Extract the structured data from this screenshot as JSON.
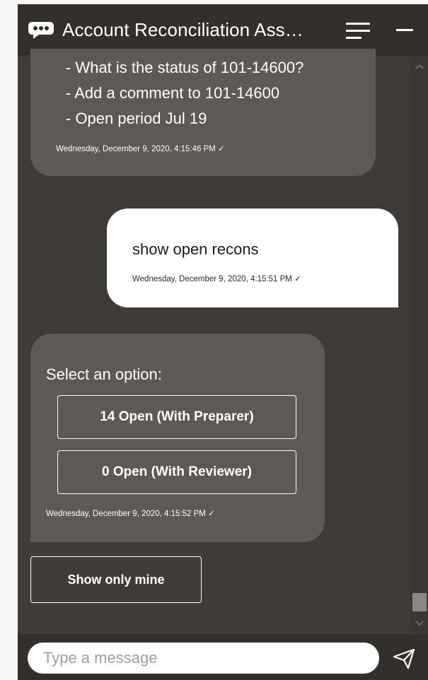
{
  "header": {
    "title": "Account Reconciliation Ass…",
    "icons": [
      "chat-icon",
      "menu-icon",
      "minimize-icon"
    ]
  },
  "messages": {
    "bot_lines": [
      "- What is the status of 101-14600?",
      "- Add a comment to 101-14600",
      "- Open period Jul 19"
    ],
    "bot_timestamp_1": "Wednesday, December 9, 2020, 4:15:46 PM ✓",
    "user_text": "show open recons",
    "user_timestamp": "Wednesday, December 9, 2020, 4:15:51 PM ✓",
    "prompt": "Select an option:",
    "options": [
      "14 Open (With Preparer)",
      "0 Open (With Reviewer)"
    ],
    "bot_timestamp_2": "Wednesday, December 9, 2020, 4:15:52 PM ✓",
    "global_action": "Show only mine"
  },
  "footer": {
    "input_placeholder": "Type a message",
    "input_value": ""
  },
  "colors": {
    "panel_bg": "#3f3c38",
    "header_bg": "#33302c",
    "bot_bubble": "#5e5955",
    "user_bubble": "#ffffff"
  }
}
